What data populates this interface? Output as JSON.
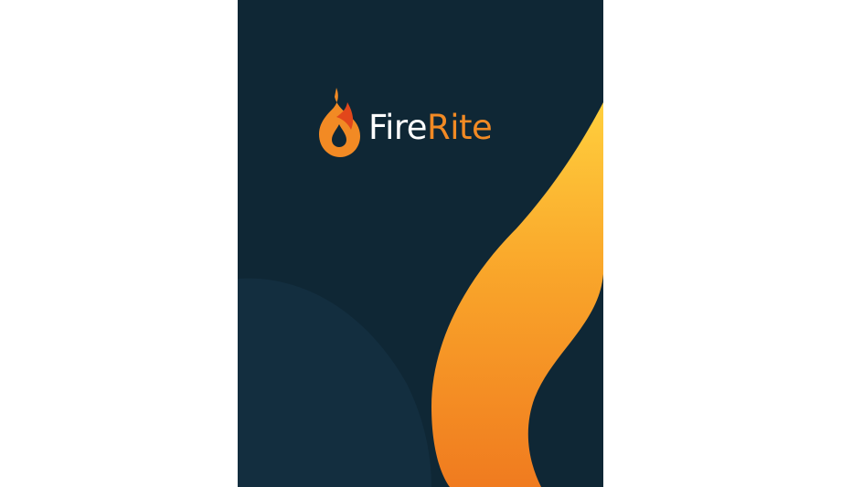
{
  "brand": {
    "name_part_1": "Fire",
    "name_part_2": "Rite",
    "logo_icon": "flame-drop-icon"
  },
  "colors": {
    "background": "#ffffff",
    "panel": "#0f2735",
    "panel_shade": "#132e3f",
    "flame_orange": "#f28a24",
    "flame_yellow": "#ffc93a",
    "flame_red": "#e2471b",
    "wordmark_white": "#ffffff"
  }
}
